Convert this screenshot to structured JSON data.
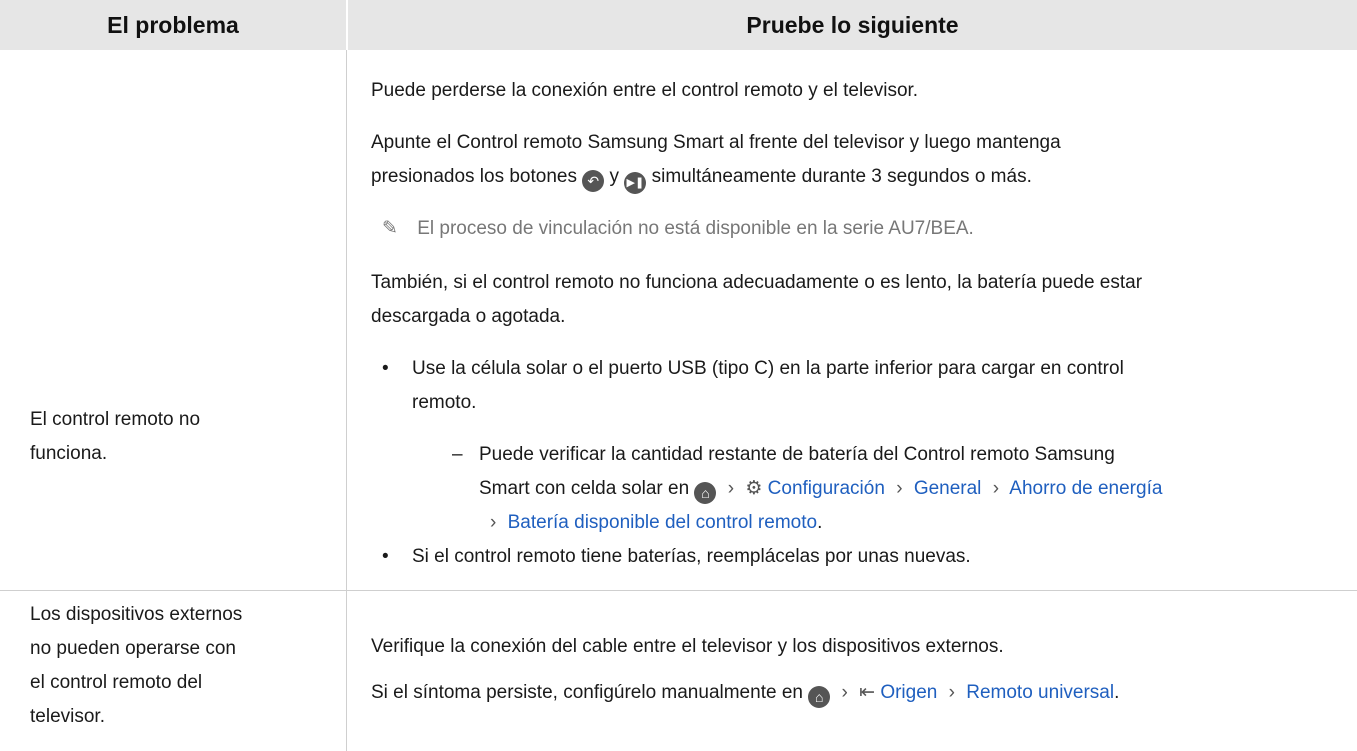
{
  "header": {
    "col1": "El problema",
    "col2": "Pruebe lo siguiente"
  },
  "row1": {
    "problem_line1": "El control remoto no",
    "problem_line2": "funciona.",
    "p1": "Puede perderse la conexión entre el control remoto y el televisor.",
    "p2_line1": "Apunte el Control remoto Samsung Smart al frente del televisor y luego mantenga",
    "p2_line2a": "presionados los botones",
    "p2_line2b": "y",
    "p2_line2c": "simultáneamente durante 3 segundos o más.",
    "note": "El proceso de vinculación no está disponible en la serie AU7/BEA.",
    "p3_line1": "También, si el control remoto no funciona adecuadamente o es lento, la batería puede estar",
    "p3_line2": "descargada o agotada.",
    "b1_line1": "Use la célula solar o el puerto USB (tipo C) en la parte inferior para cargar en control",
    "b1_line2": "remoto.",
    "sub_line1": "Puede verificar la cantidad restante de batería del Control remoto Samsung",
    "sub_line2": "Smart con celda solar en",
    "menu_settings": "Configuración",
    "menu_general": "General",
    "menu_energy": "Ahorro de energía",
    "menu_battery": "Batería disponible del control remoto",
    "b2": "Si el control remoto tiene baterías, reemplácelas por unas nuevas."
  },
  "row2": {
    "problem_line1": "Los dispositivos externos",
    "problem_line2": "no pueden operarse con",
    "problem_line3": "el control remoto del",
    "problem_line4": "televisor.",
    "p1": "Verifique la conexión del cable entre el televisor y los dispositivos externos.",
    "p2": "Si el síntoma persiste, configúrelo manualmente en",
    "menu_source": "Origen",
    "menu_universal": "Remoto universal"
  },
  "icons": [
    "home-icon",
    "gear-icon",
    "source-icon",
    "return-icon",
    "play-pause-icon",
    "pencil-icon",
    "chevron-right-icon"
  ]
}
